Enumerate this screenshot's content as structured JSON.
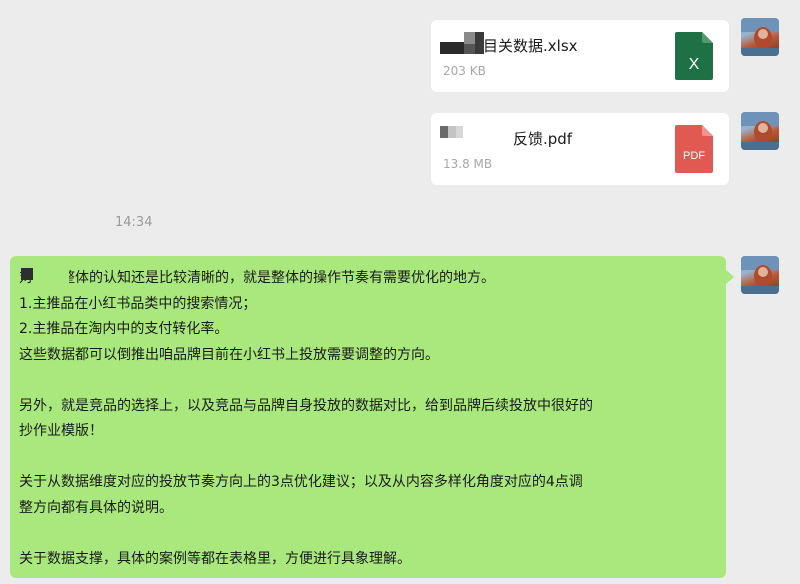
{
  "messages": {
    "file1": {
      "name": "目关数据.xlsx",
      "size": "203 KB",
      "icon": "excel-file-icon",
      "icon_letter": "X",
      "icon_color": "#1e7145"
    },
    "file2": {
      "name": "反馈.pdf",
      "size": "13.8 MB",
      "icon": "pdf-file-icon",
      "icon_letter": "PDF",
      "icon_color": "#e05a52"
    },
    "timestamp": "14:34",
    "text": {
      "lines": [
        "对自身整体的认知还是比较清晰的，就是整体的操作节奏有需要优化的地方。",
        "1.主推品在小红书品类中的搜索情况；",
        "2.主推品在淘内中的支付转化率。",
        "这些数据都可以倒推出咱品牌目前在小红书上投放需要调整的方向。",
        "",
        "另外，就是竞品的选择上，以及竞品与品牌自身投放的数据对比，给到品牌后续投放中很好的",
        "抄作业模版！",
        "",
        "关于从数据维度对应的投放节奏方向上的3点优化建议；以及从内容多样化角度对应的4点调",
        "整方向都有具体的说明。",
        "",
        "关于数据支撑，具体的案例等都在表格里，方便进行具象理解。"
      ]
    }
  },
  "colors": {
    "background": "#ececec",
    "bubble_green": "#a9e87c",
    "card_white": "#ffffff"
  }
}
